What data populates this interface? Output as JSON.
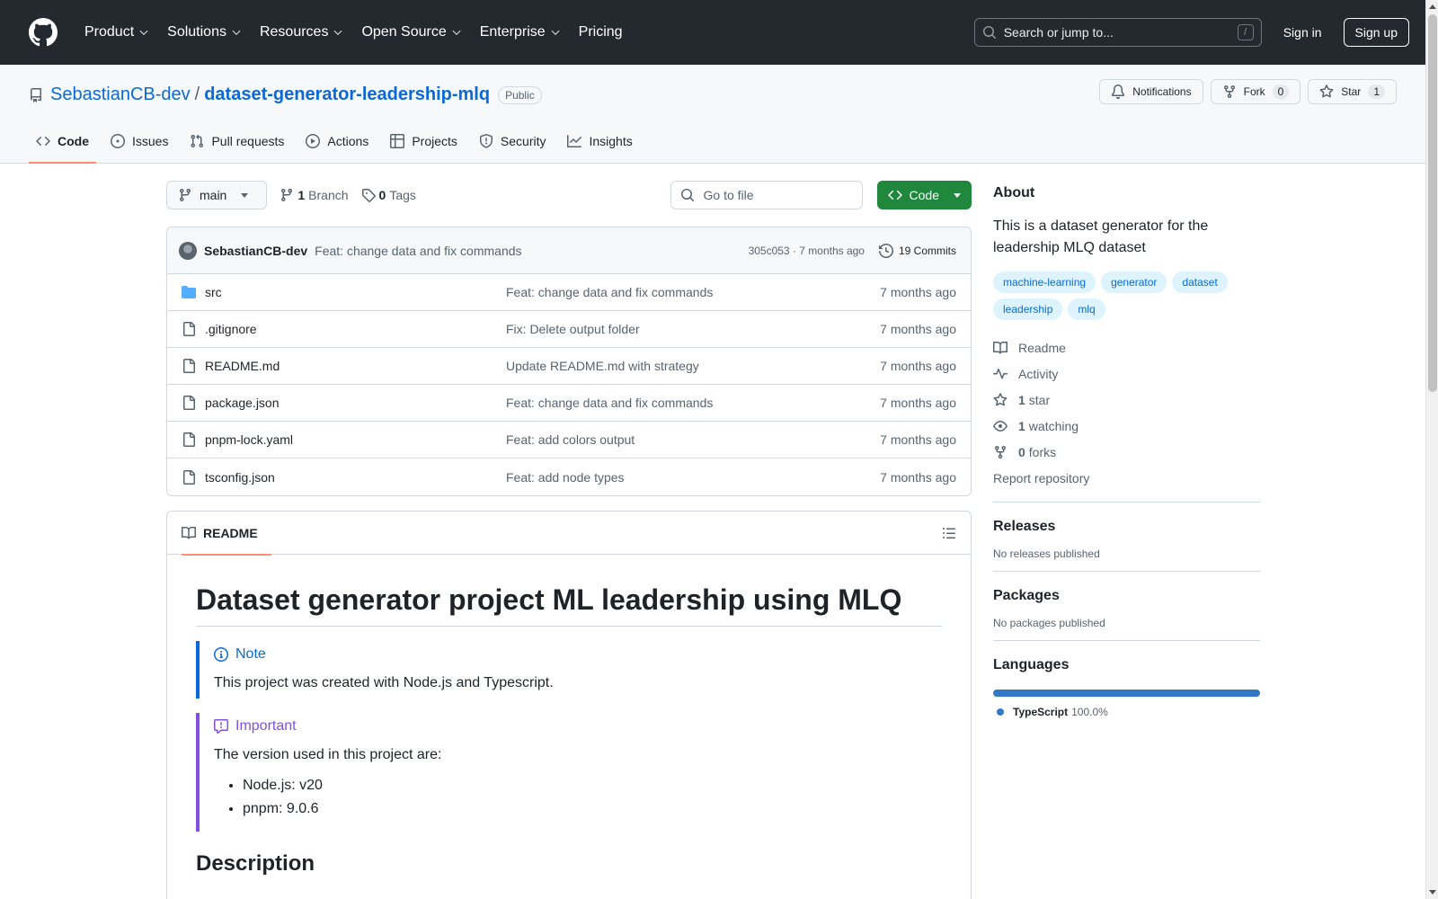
{
  "header": {
    "nav": [
      {
        "label": "Product",
        "dropdown": true
      },
      {
        "label": "Solutions",
        "dropdown": true
      },
      {
        "label": "Resources",
        "dropdown": true
      },
      {
        "label": "Open Source",
        "dropdown": true
      },
      {
        "label": "Enterprise",
        "dropdown": true
      },
      {
        "label": "Pricing",
        "dropdown": false
      }
    ],
    "search_placeholder": "Search or jump to...",
    "search_key": "/",
    "sign_in": "Sign in",
    "sign_up": "Sign up"
  },
  "repo": {
    "owner": "SebastianCB-dev",
    "separator": "/",
    "name": "dataset-generator-leadership-mlq",
    "visibility": "Public",
    "notifications_label": "Notifications",
    "fork_label": "Fork",
    "fork_count": "0",
    "star_label": "Star",
    "star_count": "1"
  },
  "repo_nav": [
    {
      "label": "Code",
      "icon": "code-icon",
      "active": true
    },
    {
      "label": "Issues",
      "icon": "issue-icon",
      "active": false
    },
    {
      "label": "Pull requests",
      "icon": "pull-request-icon",
      "active": false
    },
    {
      "label": "Actions",
      "icon": "play-icon",
      "active": false
    },
    {
      "label": "Projects",
      "icon": "table-icon",
      "active": false
    },
    {
      "label": "Security",
      "icon": "shield-icon",
      "active": false
    },
    {
      "label": "Insights",
      "icon": "graph-icon",
      "active": false
    }
  ],
  "toolbar": {
    "branch": "main",
    "branch_count": "1",
    "branch_label": "Branch",
    "tag_count": "0",
    "tag_label": "Tags",
    "goto_placeholder": "Go to file",
    "code_button": "Code"
  },
  "latest_commit": {
    "author": "SebastianCB-dev",
    "message": "Feat: change data and fix commands",
    "hash_time": "305c053 · 7 months ago",
    "commits": "19 Commits"
  },
  "files": [
    {
      "name": "src",
      "type": "folder",
      "message": "Feat: change data and fix commands",
      "age": "7 months ago"
    },
    {
      "name": ".gitignore",
      "type": "file",
      "message": "Fix: Delete output folder",
      "age": "7 months ago"
    },
    {
      "name": "README.md",
      "type": "file",
      "message": "Update README.md with strategy",
      "age": "7 months ago"
    },
    {
      "name": "package.json",
      "type": "file",
      "message": "Feat: change data and fix commands",
      "age": "7 months ago"
    },
    {
      "name": "pnpm-lock.yaml",
      "type": "file",
      "message": "Feat: add colors output",
      "age": "7 months ago"
    },
    {
      "name": "tsconfig.json",
      "type": "file",
      "message": "Feat: add node types",
      "age": "7 months ago"
    }
  ],
  "readme": {
    "tab": "README",
    "title": "Dataset generator project ML leadership using MLQ",
    "note_title": "Note",
    "note_text": "This project was created with Node.js and Typescript.",
    "important_title": "Important",
    "important_text": "The version used in this project are:",
    "versions": [
      "Node.js: v20",
      "pnpm: 9.0.6"
    ],
    "section": "Description"
  },
  "about": {
    "heading": "About",
    "description": "This is a dataset generator for the leadership MLQ dataset",
    "topics": [
      "machine-learning",
      "generator",
      "dataset",
      "leadership",
      "mlq"
    ],
    "readme": "Readme",
    "activity": "Activity",
    "stars_count": "1",
    "stars_label": "star",
    "watching_count": "1",
    "watching_label": "watching",
    "forks_count": "0",
    "forks_label": "forks",
    "report": "Report repository"
  },
  "releases": {
    "heading": "Releases",
    "text": "No releases published"
  },
  "packages": {
    "heading": "Packages",
    "text": "No packages published"
  },
  "languages": {
    "heading": "Languages",
    "items": [
      {
        "name": "TypeScript",
        "percent": "100.0%",
        "fraction": 1.0,
        "color": "#3178c6"
      }
    ]
  },
  "colors": {
    "header_bg": "#24292f",
    "link": "#0969da",
    "primary_button": "#1f883d",
    "active_tab": "#fd8c73"
  }
}
